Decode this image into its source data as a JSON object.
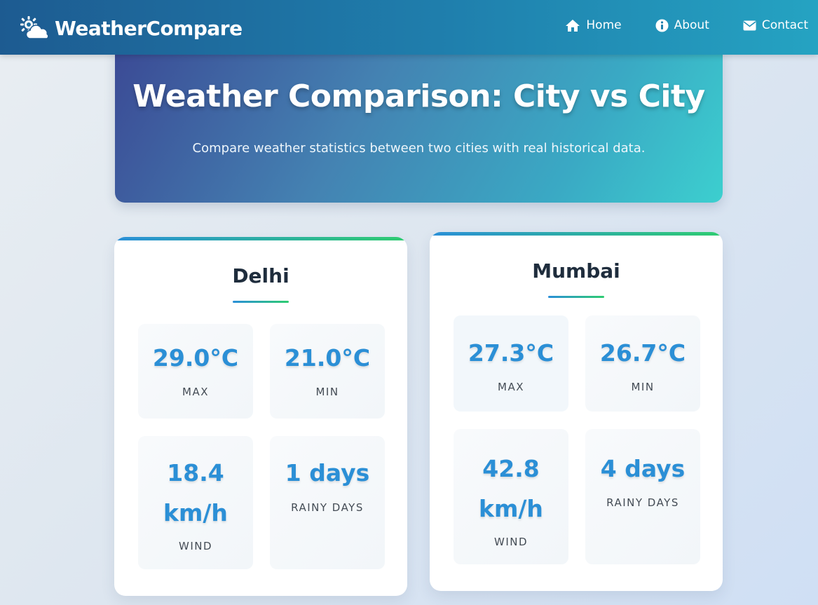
{
  "nav": {
    "brand": "WeatherCompare",
    "links": [
      {
        "label": "Home",
        "icon": "home-icon"
      },
      {
        "label": "About",
        "icon": "info-icon"
      },
      {
        "label": "Contact",
        "icon": "envelope-icon"
      }
    ]
  },
  "hero": {
    "title": "Weather Comparison: City vs City",
    "subtitle": "Compare weather statistics between two cities with real historical data."
  },
  "cities": [
    {
      "name": "Delhi",
      "max": {
        "value": "29.0°C",
        "label": "MAX"
      },
      "min": {
        "value": "21.0°C",
        "label": "MIN"
      },
      "wind": {
        "value_line1": "18.4",
        "value_line2": "km/h",
        "label": "WIND"
      },
      "rainy": {
        "value": "1 days",
        "label": "RAINY DAYS"
      }
    },
    {
      "name": "Mumbai",
      "max": {
        "value": "27.3°C",
        "label": "MAX"
      },
      "min": {
        "value": "26.7°C",
        "label": "MIN"
      },
      "wind": {
        "value_line1": "42.8",
        "value_line2": "km/h",
        "label": "WIND"
      },
      "rainy": {
        "value": "4 days",
        "label": "RAINY DAYS"
      }
    }
  ],
  "colors": {
    "accent_blue": "#2b8fd6",
    "accent_green": "#2ecc71",
    "nav_start": "#1d5b91",
    "nav_end": "#25a3c2"
  }
}
